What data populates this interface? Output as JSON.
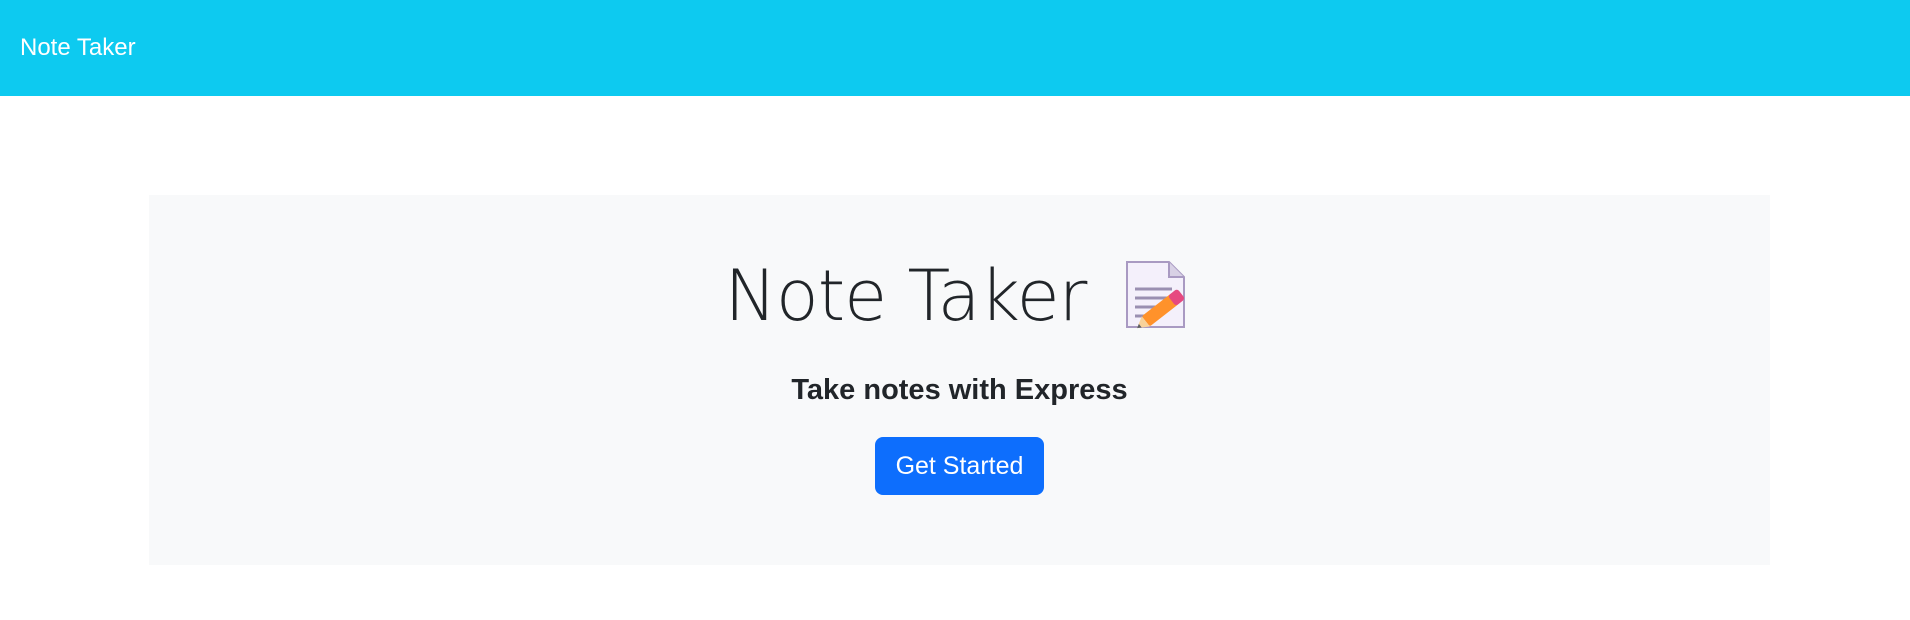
{
  "navbar": {
    "brand_label": "Note Taker",
    "background": "#0dcaf0"
  },
  "hero": {
    "title": "Note Taker",
    "icon": "memo-icon",
    "subtitle": "Take notes with Express",
    "cta_label": "Get Started",
    "background": "#f8f9fa",
    "cta_color": "#0d6efd"
  }
}
